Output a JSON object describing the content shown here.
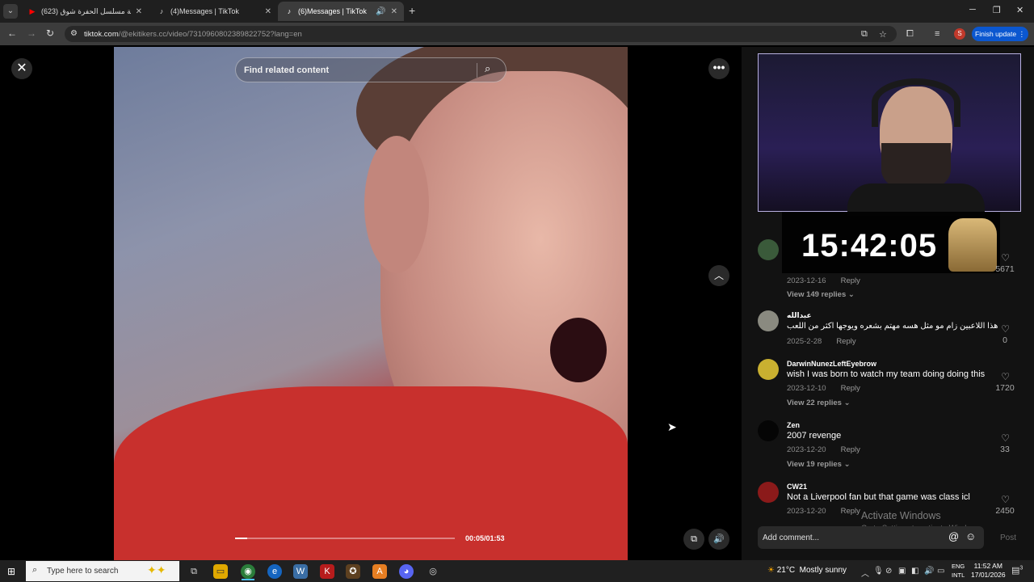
{
  "browser": {
    "tabs": [
      {
        "title": "(623) اغنية مسلسل الحفرة شوق",
        "icon": "youtube-icon"
      },
      {
        "title": "(4)Messages | TikTok",
        "icon": "tiktok-icon"
      },
      {
        "title": "(6)Messages | TikTok",
        "icon": "tiktok-icon",
        "active": true
      }
    ],
    "url_host": "tiktok.com",
    "url_path": "/@ekitikers.cc/video/7310960802389822752?lang=en",
    "profile_initial": "S",
    "finish_update_label": "Finish update"
  },
  "video": {
    "search_placeholder": "Find related content",
    "time": "00:05/01:53",
    "progress_fraction": 0.054
  },
  "overlay": {
    "clock": "15:42:05"
  },
  "comments": [
    {
      "name": "",
      "text": "",
      "date": "2023-12-16",
      "reply": "Reply",
      "likes": "5671",
      "replies": "View 149 replies",
      "avatar": "#3a5a3a"
    },
    {
      "name": "عبدالله",
      "text": "هذا اللاعبين زام مو مثل هسه مهتم بشعره ويوجها اكثر من اللعب",
      "date": "2025-2-28",
      "reply": "Reply",
      "likes": "0",
      "replies": "",
      "avatar": "#8a8a80"
    },
    {
      "name": "DarwinNunezLeftEyebrow",
      "text": "wish I was born to watch my team doing doing this",
      "date": "2023-12-10",
      "reply": "Reply",
      "likes": "1720",
      "replies": "View 22 replies",
      "avatar": "#c9b030"
    },
    {
      "name": "Zen",
      "text": "2007 revenge",
      "date": "2023-12-20",
      "reply": "Reply",
      "likes": "33",
      "replies": "View 19 replies",
      "avatar": "#050505"
    },
    {
      "name": "CW21",
      "text": "Not a Liverpool fan but that game was class icl",
      "date": "2023-12-20",
      "reply": "Reply",
      "likes": "2450",
      "replies": "",
      "avatar": "#8b1a1a"
    }
  ],
  "comment_input": {
    "placeholder": "Add comment...",
    "post_label": "Post"
  },
  "watermark": {
    "line1": "Activate Windows",
    "line2": "Go to Settings to activate Windows."
  },
  "taskbar": {
    "search_label": "Type here to search",
    "weather_temp": "21°C",
    "weather_text": "Mostly sunny",
    "lang_line1": "ENG",
    "lang_line2": "INTL",
    "time": "11:52 AM",
    "date": "17/01/2026",
    "notif_count": "3"
  }
}
